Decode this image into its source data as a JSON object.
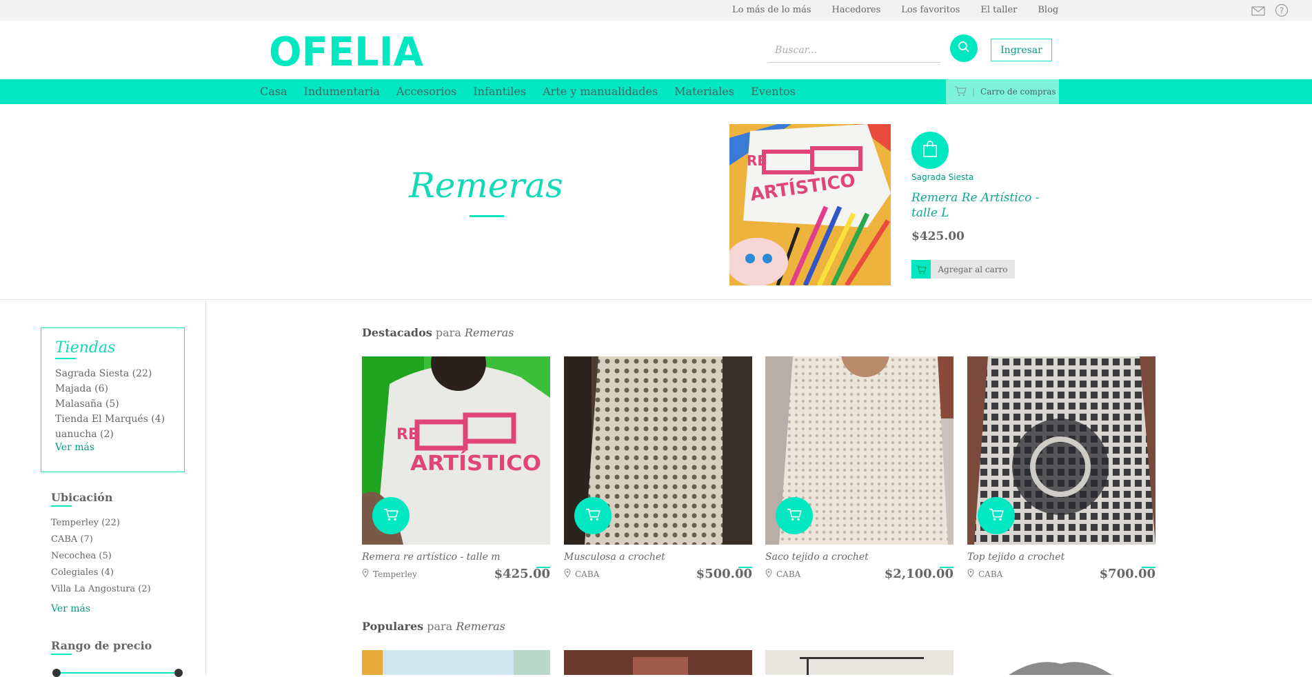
{
  "topbar": {
    "links": [
      "Lo más de lo más",
      "Hacedores",
      "Los favoritos",
      "El taller",
      "Blog"
    ],
    "icons": [
      "mail-icon",
      "help-icon"
    ]
  },
  "header": {
    "logo_text": "OFELIA",
    "search_placeholder": "Buscar...",
    "login_label": "Ingresar"
  },
  "nav": {
    "categories": [
      "Casa",
      "Indumentaria",
      "Accesorios",
      "Infantiles",
      "Arte y manualidades",
      "Materiales",
      "Eventos"
    ],
    "cart_label": "Carro de compras",
    "cart_separator": "|"
  },
  "hero": {
    "title": "Remeras",
    "featured": {
      "shop": "Sagrada Siesta",
      "name": "Remera Re Artístico - talle L",
      "price": "$425.00",
      "add_to_cart": "Agregar al carro",
      "image_text_1": "RE",
      "image_text_2": "ARTÍSTICO"
    }
  },
  "sidebar": {
    "stores_title": "Tiendas",
    "stores": [
      "Sagrada Siesta (22)",
      "Majada (6)",
      "Malasaña (5)",
      "Tienda El Marqués (4)",
      "uanucha (2)"
    ],
    "stores_more": "Ver más",
    "location_title": "Ubicación",
    "locations": [
      "Temperley (22)",
      "CABA (7)",
      "Necochea (5)",
      "Colegiales (4)",
      "Villa La Angostura (2)"
    ],
    "locations_more": "Ver más",
    "price_title": "Rango de precio"
  },
  "featured_section": {
    "title_bold": "Destacados",
    "title_mid": "para",
    "title_italic": "Remeras",
    "products": [
      {
        "name": "Remera re artístico - talle m",
        "location": "Temperley",
        "price": "$425.00"
      },
      {
        "name": "Musculosa a crochet",
        "location": "CABA",
        "price": "$500.00"
      },
      {
        "name": "Saco tejido a crochet",
        "location": "CABA",
        "price": "$2,100.00"
      },
      {
        "name": "Top tejido a crochet",
        "location": "CABA",
        "price": "$700.00"
      }
    ]
  },
  "popular_section": {
    "title_bold": "Populares",
    "title_mid": "para",
    "title_italic": "Remeras"
  },
  "colors": {
    "accent": "#00e8c2",
    "accent_dark": "#009d80"
  }
}
